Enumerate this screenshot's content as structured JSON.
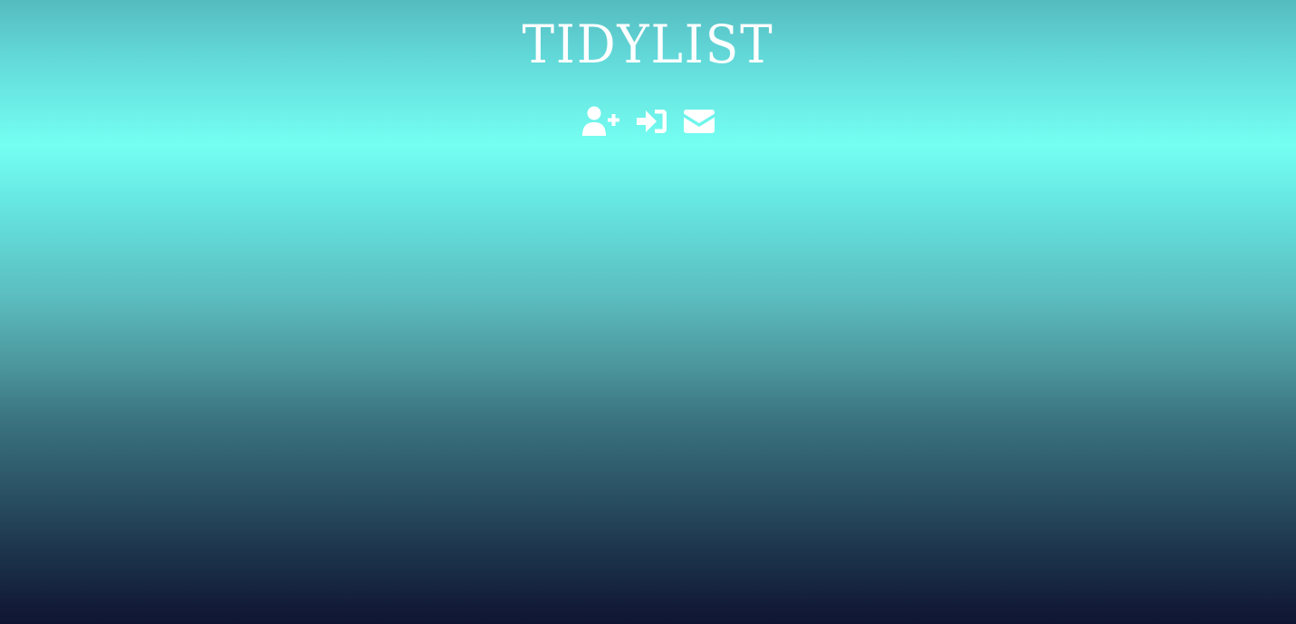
{
  "header": {
    "title": "TIDYLIST"
  },
  "nav": {
    "items": [
      {
        "icon": "user-plus-icon",
        "action": "register"
      },
      {
        "icon": "sign-in-icon",
        "action": "login"
      },
      {
        "icon": "envelope-icon",
        "action": "contact"
      }
    ]
  },
  "colors": {
    "text": "#ffffff",
    "gradient_top": "#55bbbf",
    "gradient_highlight": "#74fff2",
    "gradient_bottom": "#0f1433"
  }
}
